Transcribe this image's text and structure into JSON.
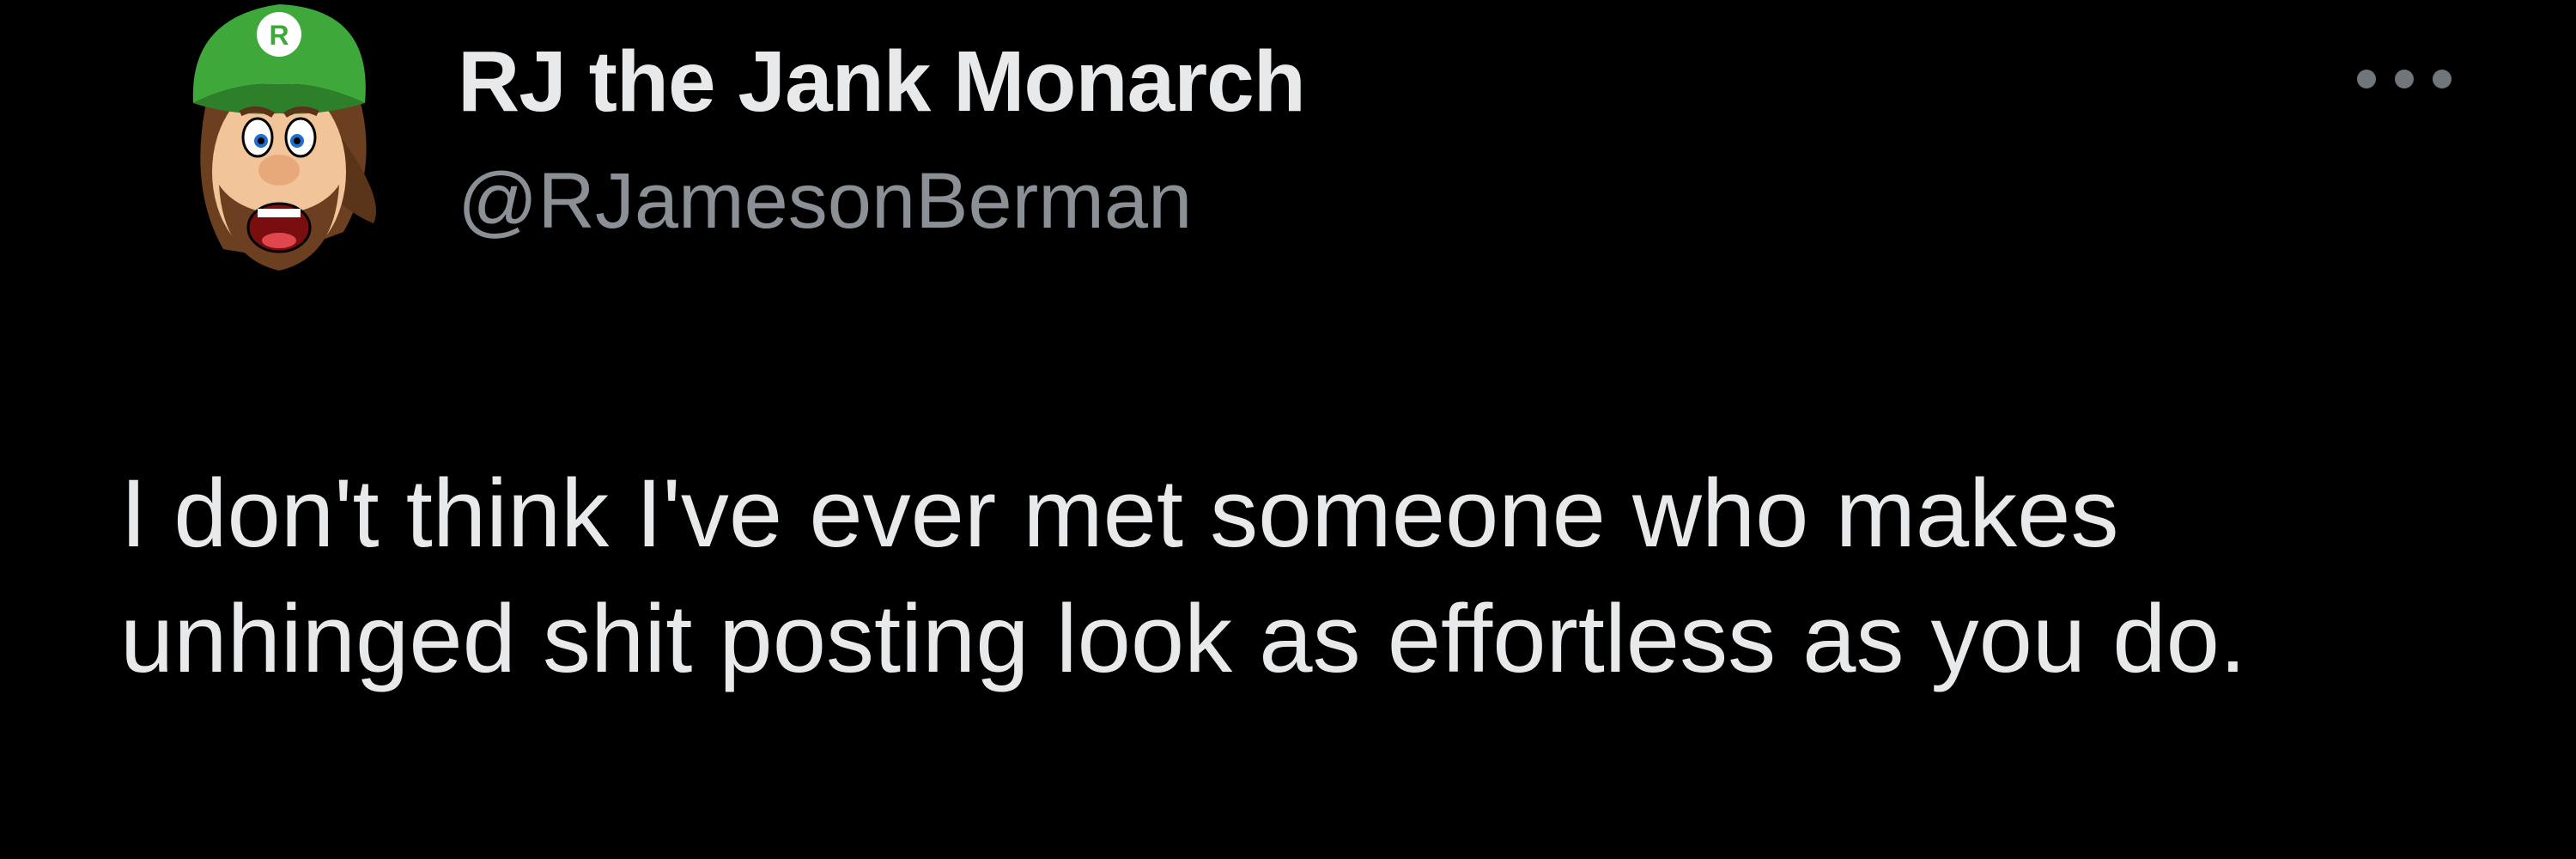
{
  "tweet": {
    "author": {
      "display_name": "RJ the Jank Monarch",
      "handle": "@RJamesonBerman",
      "avatar_icon": "cartoon-plumber-avatar-icon",
      "avatar_cap_letter": "R"
    },
    "more_icon": "ellipsis-icon",
    "text": "I don't think I've ever met someone who makes unhinged shit posting look as effortless as you do."
  },
  "colors": {
    "background": "#000000",
    "primary_text": "#e7e9ea",
    "secondary_text": "#8b9096",
    "avatar_cap": "#3fa83a"
  }
}
